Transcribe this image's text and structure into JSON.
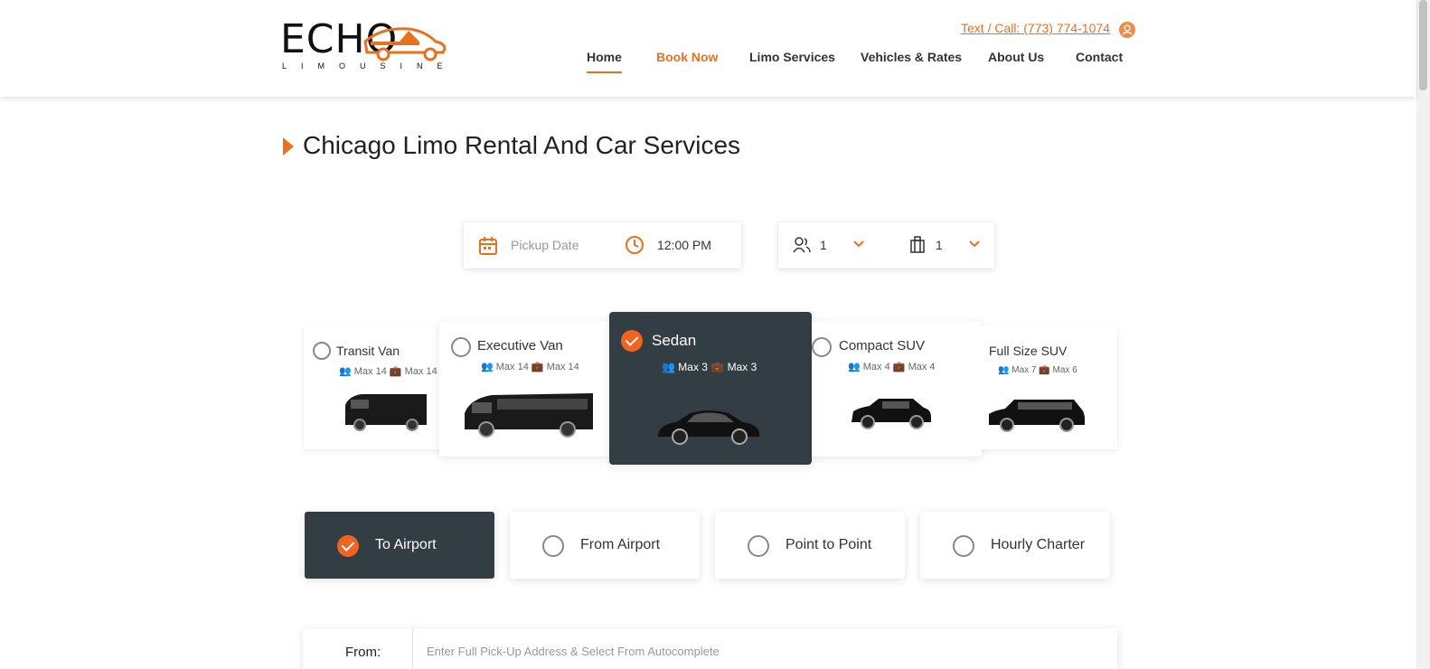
{
  "header": {
    "logo_word": "ECHO",
    "logo_sub": "LIMOUSINE",
    "phone": "Text / Call: (773) 774-1074",
    "nav": [
      "Home",
      "Book Now",
      "Limo Services",
      "Vehicles & Rates",
      "About Us",
      "Contact"
    ]
  },
  "title": "Chicago Limo Rental And Car Services",
  "booking": {
    "pickup_date_placeholder": "Pickup Date",
    "time": "12:00 PM",
    "passengers": "1",
    "luggage": "1"
  },
  "vehicles": [
    {
      "name": "Transit Van",
      "pax": "Max 14",
      "bags": "Max 14",
      "selected": false
    },
    {
      "name": "Executive Van",
      "pax": "Max 14",
      "bags": "Max 14",
      "selected": false
    },
    {
      "name": "Sedan",
      "pax": "Max 3",
      "bags": "Max 3",
      "selected": true
    },
    {
      "name": "Compact SUV",
      "pax": "Max 4",
      "bags": "Max 4",
      "selected": false
    },
    {
      "name": "Full Size SUV",
      "pax": "Max 7",
      "bags": "Max 6",
      "selected": false
    }
  ],
  "trip_types": [
    {
      "label": "To Airport",
      "selected": true
    },
    {
      "label": "From Airport",
      "selected": false
    },
    {
      "label": "Point to Point",
      "selected": false
    },
    {
      "label": "Hourly Charter",
      "selected": false
    }
  ],
  "from": {
    "label": "From:",
    "placeholder": "Enter Full Pick-Up Address & Select From Autocomplete"
  },
  "colors": {
    "accent": "#e8711f",
    "dark": "#323d44"
  }
}
